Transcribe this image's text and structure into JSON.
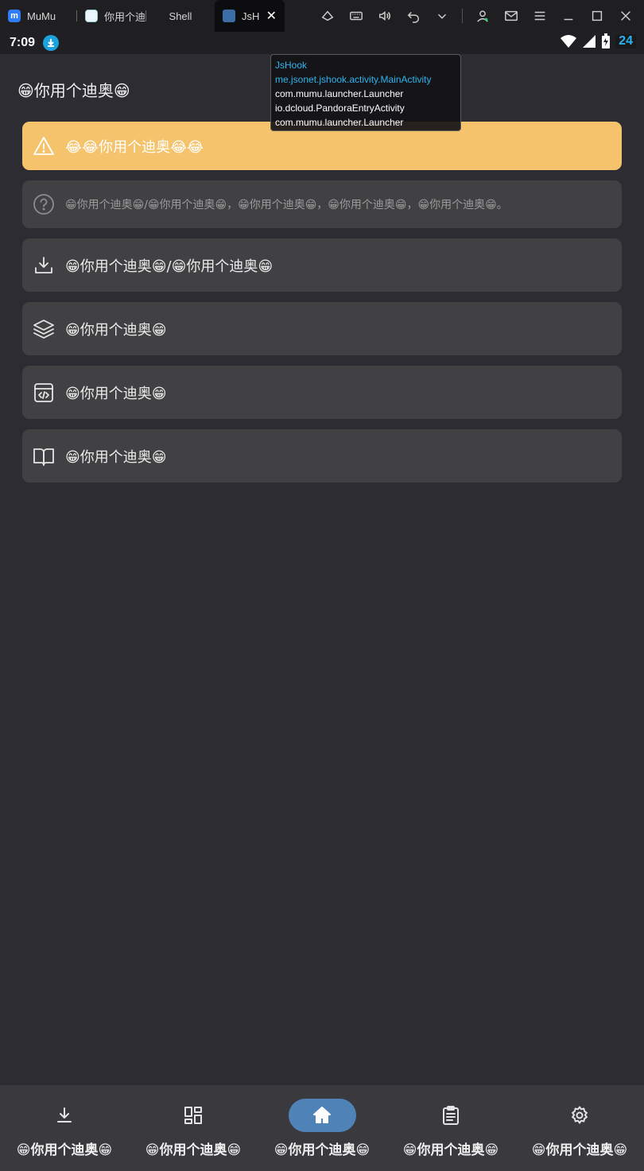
{
  "window": {
    "tabs": [
      {
        "label": "MuMu",
        "icon": "mumu-logo-icon"
      },
      {
        "label": "你用个迪",
        "icon": "app-thumbnail-icon"
      },
      {
        "label": "Shell",
        "icon": ""
      },
      {
        "label": "JsHo",
        "icon": "jshook-logo-icon"
      }
    ],
    "toolbar_icons": [
      "screen-rotate-icon",
      "keyboard-icon",
      "volume-icon",
      "back-icon",
      "chevron-down-icon",
      "account-icon",
      "mail-icon",
      "menu-icon",
      "minimize-icon",
      "maximize-icon",
      "close-icon"
    ]
  },
  "statusbar": {
    "time": "7:09",
    "battery_level": "24"
  },
  "tooltip": {
    "app_name": "JsHook",
    "activity": "me.jsonet.jshook.activity.MainActivity",
    "line3": "com.mumu.launcher.Launcher",
    "line4": "io.dcloud.PandoraEntryActivity",
    "line5": "com.mumu.launcher.Launcher"
  },
  "app": {
    "title": "😁你用个迪奥😁",
    "cards": {
      "warning": "😂😂你用个迪奥😂😂",
      "help": "😁你用个迪奥😁/😁你用个迪奥😁，😁你用个迪奥😁，😁你用个迪奥😁，😁你用个迪奥😁。",
      "download": "😁你用个迪奥😁/😁你用个迪奥😁",
      "layers": "😁你用个迪奥😁",
      "code": "😁你用个迪奥😁",
      "book": "😁你用个迪奥😁"
    }
  },
  "bottom_nav": {
    "items": [
      {
        "label": "😁你用个迪奥😁",
        "icon": "download-icon"
      },
      {
        "label": "😁你用个迪奥😁",
        "icon": "dashboard-icon"
      },
      {
        "label": "😁你用个迪奥😁",
        "icon": "home-icon",
        "active": true
      },
      {
        "label": "😁你用个迪奥😁",
        "icon": "clipboard-icon"
      },
      {
        "label": "😁你用个迪奥😁",
        "icon": "gear-icon"
      }
    ],
    "active_color": "#4f83b8"
  },
  "colors": {
    "background": "#2c2c32",
    "card": "#414144",
    "warning_card": "#f5c36b",
    "accent": "#2fb4ef"
  }
}
